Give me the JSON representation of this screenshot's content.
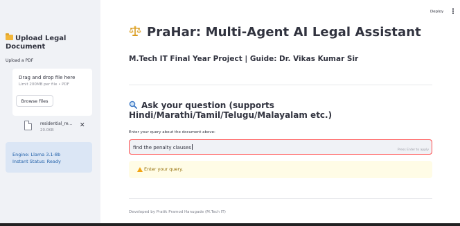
{
  "header": {
    "deploy_label": "Deploy"
  },
  "sidebar": {
    "upload_title": "Upload Legal Document",
    "upload_label": "Upload a PDF",
    "dropzone_title": "Drag and drop file here",
    "dropzone_limit": "Limit 200MB per file • PDF",
    "browse_label": "Browse files",
    "file_name": "residential_re...",
    "file_size": "20.0KB",
    "engine_status": "Engine: Llama 3.1-8b",
    "instant_status": "Instant Status: Ready"
  },
  "main": {
    "title": "PraHar: Multi-Agent AI Legal Assistant",
    "subtitle": "M.Tech IT Final Year Project | Guide: Dr. Vikas Kumar Sir",
    "ask_heading": "Ask your question (supports Hindi/Marathi/Tamil/Telugu/Malayalam etc.)",
    "input_label": "Enter your query about the document above:",
    "query_value": "find the penalty clauses",
    "query_hint": "Press Enter to apply",
    "warning_text": "Enter your query.",
    "footer": "Developed by Pratik Pramod Hanugade (M.Tech IT)"
  },
  "colors": {
    "sidebar_bg": "#f0f2f6",
    "status_bg": "#dbe6f5",
    "status_text": "#1f5fa8",
    "input_border": "#ff4b4b",
    "warning_bg": "#fffce6",
    "warning_text": "#926c05"
  }
}
